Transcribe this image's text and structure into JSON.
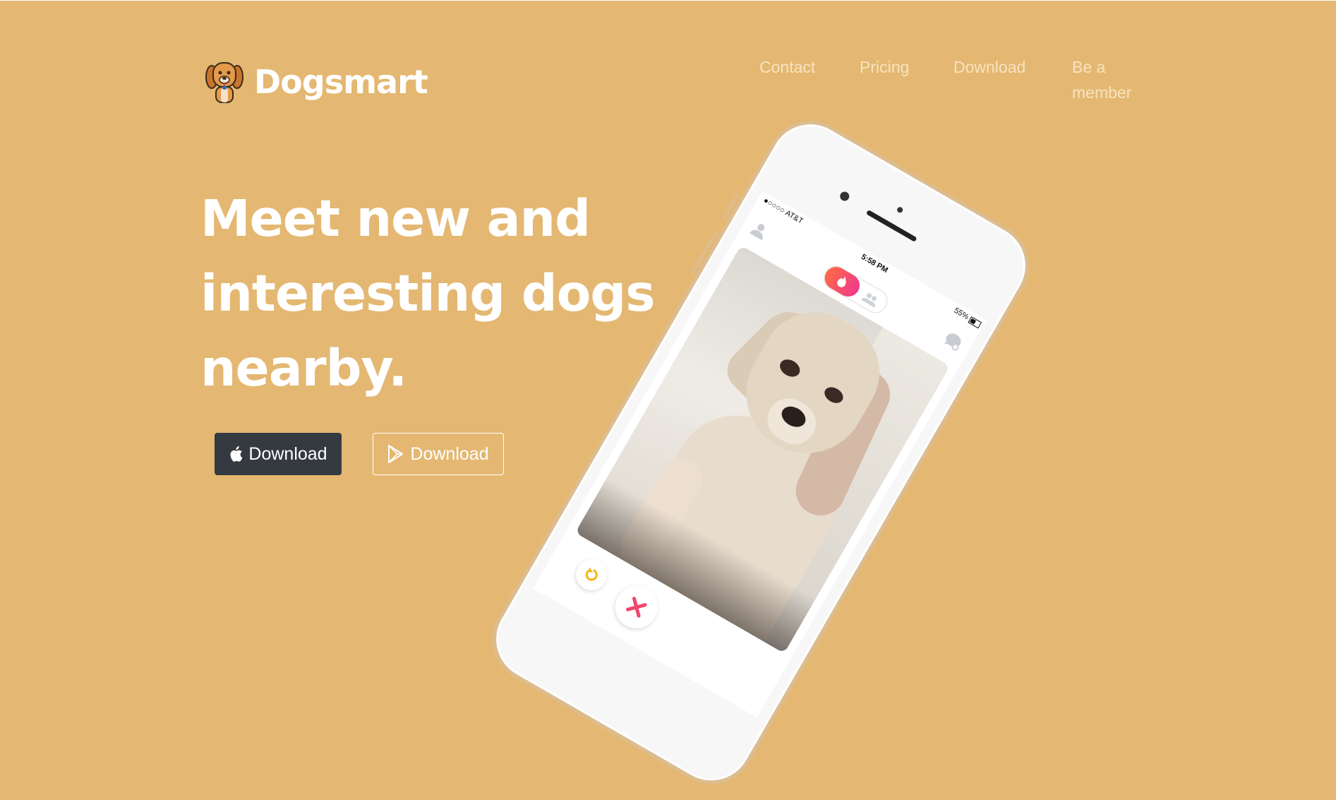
{
  "brand": {
    "name": "Dogsmart",
    "logo_icon": "dog-face-icon"
  },
  "nav": {
    "contact": "Contact",
    "pricing": "Pricing",
    "download": "Download",
    "member": "Be a member"
  },
  "hero": {
    "headline": "Meet new and interesting dogs nearby.",
    "apple_button": {
      "label": "Download",
      "icon": "apple-icon"
    },
    "play_button": {
      "label": "Download",
      "icon": "google-play-icon"
    }
  },
  "phone": {
    "status": {
      "carrier": "●○○○○ AT&T",
      "time": "5:58 PM",
      "battery": "55%"
    }
  },
  "colors": {
    "background": "#e4b872",
    "apple_button_bg": "#353a41",
    "nav_text": "#f8e3bf",
    "accent_gradient_start": "#ff6a47",
    "accent_gradient_end": "#f0398c"
  }
}
